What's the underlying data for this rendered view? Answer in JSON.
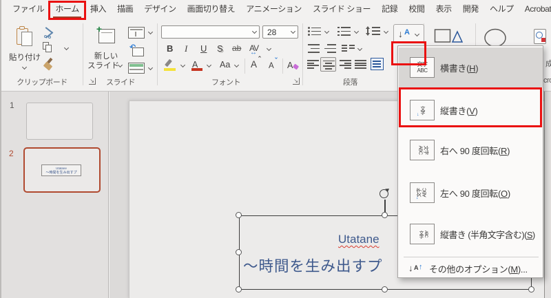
{
  "menubar": {
    "tabs": [
      "ファイル",
      "ホーム",
      "挿入",
      "描画",
      "デザイン",
      "画面切り替え",
      "アニメーション",
      "スライド ショー",
      "記録",
      "校閲",
      "表示",
      "開発",
      "ヘルプ",
      "Acrobat"
    ],
    "active_tab": "ホーム"
  },
  "ribbon": {
    "clipboard": {
      "paste": "貼り付け",
      "label": "クリップボード"
    },
    "slides": {
      "new_slide_line1": "新しい",
      "new_slide_line2": "スライド",
      "label": "スライド"
    },
    "font": {
      "size": "28",
      "bold": "B",
      "italic": "I",
      "underline": "U",
      "shadow": "S",
      "strike": "ab",
      "spacing": "AV",
      "case": "Aa",
      "grow": "A",
      "shrink": "A",
      "clear": "A",
      "label": "フォント"
    },
    "paragraph": {
      "label": "段落"
    },
    "acrobat": {
      "fragment1": "成",
      "fragment2": "cro"
    }
  },
  "text_direction_menu": {
    "paren_open": "(",
    "paren_close": ")",
    "icon_moji": "文字",
    "icon_abc": "ABC",
    "items": [
      {
        "text": "横書き",
        "key": "H",
        "suffix": ""
      },
      {
        "text": "縦書き",
        "key": "V",
        "suffix": ""
      },
      {
        "text": "右へ 90 度回転",
        "key": "R",
        "suffix": ""
      },
      {
        "text": "左へ 90 度回転",
        "key": "O",
        "suffix": ""
      },
      {
        "text": "縦書き (半角文字含む)",
        "key": "S",
        "suffix": ""
      },
      {
        "text": "その他のオプション",
        "key": "M",
        "suffix": "..."
      }
    ],
    "selected_item": "横書き(H)"
  },
  "slides_panel": {
    "slide1_number": "1",
    "slide2_number": "2"
  },
  "canvas": {
    "line1": "Utatane",
    "line2": "～時間を生み出すプ"
  },
  "colors": {
    "annotation": "#ea1111",
    "accent_selected_slide": "#b0492f",
    "slide_text_blue": "#3e598c",
    "active_tab_underline": "#a03d28"
  }
}
